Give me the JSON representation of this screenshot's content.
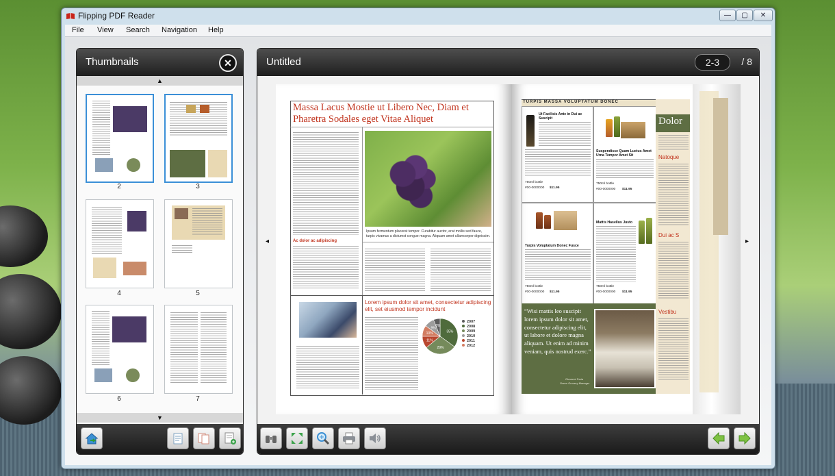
{
  "window": {
    "title": "Flipping PDF Reader",
    "controls": [
      "—",
      "▢",
      "✕"
    ]
  },
  "menu": [
    "File",
    "View",
    "Search",
    "Navigation",
    "Help"
  ],
  "thumbnails_panel": {
    "title": "Thumbnails",
    "close_symbol": "✕",
    "scroll_up_symbol": "▲",
    "scroll_down_symbol": "▼",
    "thumbnail_labels": [
      "2",
      "3",
      "4",
      "5",
      "6",
      "7"
    ],
    "selected_pages": [
      "2",
      "3"
    ]
  },
  "document": {
    "title": "Untitled",
    "page_indicator": "2-3",
    "total_pages": "/ 8",
    "prev_symbol": "◂",
    "next_symbol": "▸"
  },
  "left_page": {
    "headline": "Massa Lacus Mostie ut Libero Nec, Diam et Pharetra Sodales eget Vitae Aliquet",
    "photo_caption": "Ipsum fermentum placerat tempor. Curabitur auctor, erat mollis sed fauce, turpis vivamus a dictumst congue magna. Aliquam amet ullamcorper dignissim.",
    "subhead": "Ac dolor ac adipiscing",
    "lower_headline": "Lorem ipsum dolor sit amet, consectetur adipiscing elit, set eiusmod tempor incidunt",
    "pie_slices": [
      {
        "label": "35%",
        "value": 35,
        "color": "#4f6b3c"
      },
      {
        "label": "29%",
        "value": 29,
        "color": "#758a5b"
      },
      {
        "label": "11%",
        "value": 11,
        "color": "#b9472f"
      },
      {
        "label": "10%",
        "value": 10,
        "color": "#d27d62"
      },
      {
        "label": "9%",
        "value": 9,
        "color": "#9c9c9c"
      },
      {
        "label": "6%",
        "value": 6,
        "color": "#5c5c5c"
      }
    ],
    "pie_legend": [
      "2007",
      "2008",
      "2009",
      "2010",
      "2011",
      "2012"
    ],
    "pie_legend_colors": [
      "#5c5c5c",
      "#4f6b3c",
      "#758a5b",
      "#9c9c9c",
      "#b9472f",
      "#d27d62"
    ]
  },
  "right_page": {
    "header": "TURPIS MASSA VOLUPTATUM DONEC",
    "products": [
      {
        "name": "Ut Facilisis Ante in Dui ac Suscipit",
        "size": "750ml bottle",
        "code": "#00-0000000",
        "price": "$11.95"
      },
      {
        "name": "Suspendisse Quam Luctus Amet Urna Tempor Amet Sit",
        "size": "750ml bottle",
        "code": "#00-0000000",
        "price": "$11.95"
      },
      {
        "name": "Turpis Voluptatum Donec Fusce",
        "size": "750ml bottle",
        "code": "#00-0000000",
        "price": "$11.95"
      },
      {
        "name": "Mattis Hasellus Justo",
        "size": "750ml bottle",
        "code": "#00-0000000",
        "price": "$11.95"
      }
    ],
    "quote": "“Wisi mattis leo suscipit lorem ipsum dolor sit amet, consectetur adipiscing elit, ut labore et dolore magna aliquam. Ut enim ad minim veniam, quis nostrud exerc.”",
    "quote_author": "Giovanni Faria",
    "quote_role": "Green Grocery Manager",
    "side_title": "Dolor",
    "side_headers": [
      "Natoque",
      "Dui ac S",
      "Vestibu"
    ]
  },
  "colors": {
    "accent_red": "#c1331d",
    "olive": "#5e6e43",
    "selection_blue": "#3a8fd7"
  }
}
